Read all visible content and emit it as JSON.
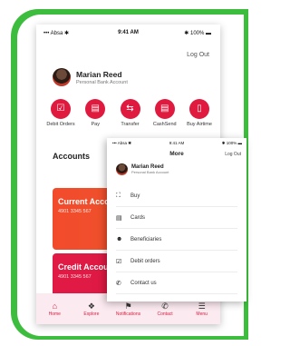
{
  "colors": {
    "frame": "#3dbd3d",
    "accent": "#e0193e"
  },
  "back": {
    "status": {
      "carrier": "••• Absa ✱",
      "time": "9:41 AM",
      "battery": "✱ 100% ▬"
    },
    "logout": "Log Out",
    "user": {
      "name": "Marian Reed",
      "subtitle": "Personal Bank Account"
    },
    "actions": [
      {
        "label": "Debit Orders",
        "icon": "debit-orders-icon"
      },
      {
        "label": "Pay",
        "icon": "pay-icon"
      },
      {
        "label": "Transfer",
        "icon": "transfer-icon"
      },
      {
        "label": "CashSend",
        "icon": "cashsend-icon"
      },
      {
        "label": "Buy Airtime",
        "icon": "phone-icon"
      }
    ],
    "accounts_title": "Accounts",
    "cards": [
      {
        "title": "Current Account",
        "number": "4901 3345 567"
      },
      {
        "title": "Credit Account",
        "number": "4901 3345 567"
      }
    ],
    "nav": [
      {
        "label": "Home",
        "icon": "home-icon"
      },
      {
        "label": "Explore",
        "icon": "explore-icon"
      },
      {
        "label": "Notifications",
        "icon": "notifications-icon"
      },
      {
        "label": "Contact",
        "icon": "phone-icon"
      },
      {
        "label": "Menu",
        "icon": "menu-icon"
      }
    ]
  },
  "front": {
    "status": {
      "carrier": "••• Absa ✱",
      "time": "9:41 AM",
      "battery": "✱ 100% ▬"
    },
    "title": "More",
    "logout": "Log Out",
    "user": {
      "name": "Marian Reed",
      "subtitle": "Personal Bank Account"
    },
    "menu": [
      {
        "label": "Buy",
        "icon": "cart-icon"
      },
      {
        "label": "Cards",
        "icon": "card-icon"
      },
      {
        "label": "Beneficiaries",
        "icon": "people-icon"
      },
      {
        "label": "Debit orders",
        "icon": "checkbox-icon"
      },
      {
        "label": "Contact us",
        "icon": "phone-icon"
      }
    ]
  }
}
